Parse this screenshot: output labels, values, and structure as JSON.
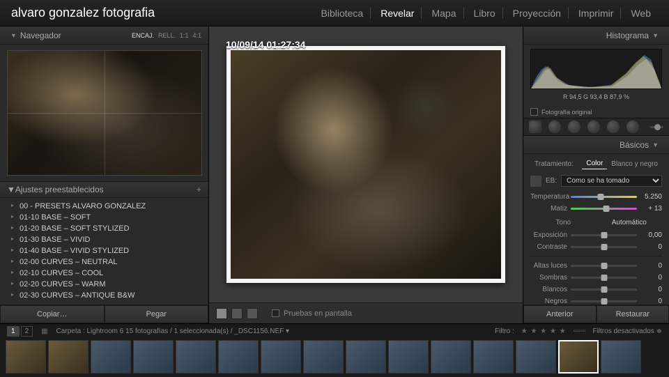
{
  "identity": "alvaro gonzalez fotografia",
  "modules": [
    "Biblioteca",
    "Revelar",
    "Mapa",
    "Libro",
    "Proyección",
    "Imprimir",
    "Web"
  ],
  "active_module": "Revelar",
  "navigator": {
    "title": "Navegador",
    "modes": [
      "ENCAJ.",
      "RELL.",
      "1:1",
      "4:1"
    ],
    "selected": "ENCAJ."
  },
  "timestamp": "10/09/14 01:27:34",
  "presets": {
    "title": "Ajustes preestablecidos",
    "items": [
      "00 - PRESETS ALVARO GONZALEZ",
      "01-10 BASE – SOFT",
      "01-20 BASE – SOFT STYLIZED",
      "01-30 BASE – VIVID",
      "01-40 BASE – VIVID STYLIZED",
      "02-00 CURVES – NEUTRAL",
      "02-10 CURVES – COOL",
      "02-20 CURVES – WARM",
      "02-30 CURVES – ANTIQUE B&W"
    ]
  },
  "left_buttons": {
    "copy": "Copiar…",
    "paste": "Pegar"
  },
  "center_toolbar": {
    "soft_proof": "Pruebas en pantalla"
  },
  "histogram": {
    "title": "Histograma",
    "readout": "R  94,5   G  93,4   B  87,9 %",
    "original": "Fotografía original"
  },
  "basics": {
    "title": "Básicos",
    "treatment": {
      "label": "Tratamiento:",
      "color": "Color",
      "bw": "Blanco y negro"
    },
    "wb": {
      "label": "EB:",
      "preset": "Como se ha tomado"
    },
    "temp": {
      "label": "Temperatura",
      "value": "5.250",
      "pos": 45
    },
    "tint": {
      "label": "Matiz",
      "value": "+ 13",
      "pos": 54
    },
    "tone_label": "Tono",
    "auto_label": "Automático",
    "sliders": [
      {
        "label": "Exposición",
        "value": "0,00",
        "pos": 50
      },
      {
        "label": "Contraste",
        "value": "0",
        "pos": 50
      },
      {
        "label": "Altas luces",
        "value": "0",
        "pos": 50
      },
      {
        "label": "Sombras",
        "value": "0",
        "pos": 50
      },
      {
        "label": "Blancos",
        "value": "0",
        "pos": 50
      },
      {
        "label": "Negros",
        "value": "0",
        "pos": 50
      }
    ]
  },
  "right_buttons": {
    "prev": "Anterior",
    "reset": "Restaurar"
  },
  "filmstrip": {
    "pages": [
      "1",
      "2"
    ],
    "path": "Carpeta : Lightroom 6    15 fotografías / 1 seleccionada(s) / _DSC1156.NEF ▾",
    "filter_label": "Filtro :",
    "filters_off": "Filtros desactivados ≑"
  }
}
